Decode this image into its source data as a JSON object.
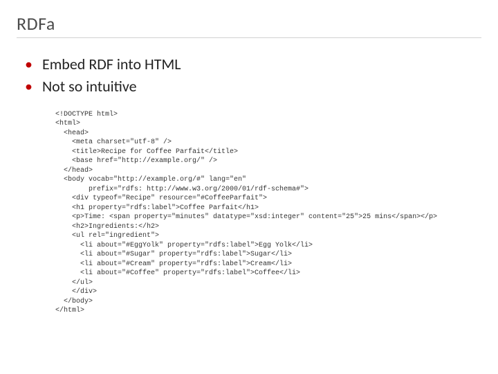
{
  "slide": {
    "title": "RDFa",
    "bullets": [
      "Embed RDF into HTML",
      "Not so intuitive"
    ],
    "code_lines": [
      "<!DOCTYPE html>",
      "<html>",
      "  <head>",
      "    <meta charset=\"utf-8\" />",
      "    <title>Recipe for Coffee Parfait</title>",
      "    <base href=\"http://example.org/\" />",
      "  </head>",
      "  <body vocab=\"http://example.org/#\" lang=\"en\"",
      "        prefix=\"rdfs: http://www.w3.org/2000/01/rdf-schema#\">",
      "    <div typeof=\"Recipe\" resource=\"#CoffeeParfait\">",
      "    <h1 property=\"rdfs:label\">Coffee Parfait</h1>",
      "    <p>Time: <span property=\"minutes\" datatype=\"xsd:integer\" content=\"25\">25 mins</span></p>",
      "    <h2>Ingredients:</h2>",
      "    <ul rel=\"ingredient\">",
      "      <li about=\"#EggYolk\" property=\"rdfs:label\">Egg Yolk</li>",
      "      <li about=\"#Sugar\" property=\"rdfs:label\">Sugar</li>",
      "      <li about=\"#Cream\" property=\"rdfs:label\">Cream</li>",
      "      <li about=\"#Coffee\" property=\"rdfs:label\">Coffee</li>",
      "    </ul>",
      "    </div>",
      "  </body>",
      "</html>"
    ]
  }
}
